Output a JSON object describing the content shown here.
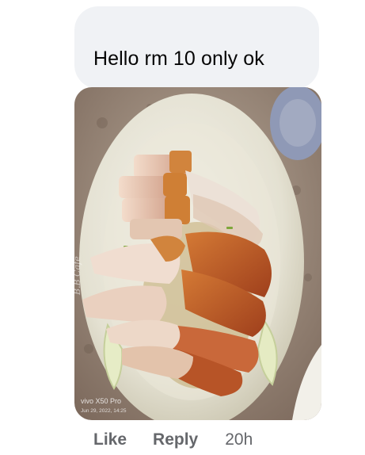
{
  "comment": {
    "text": "Hello rm 10 only ok"
  },
  "photo": {
    "description_icon": "food-photo",
    "watermark_logo": "B.B Cafe",
    "watermark_device": "vivo X50 Pro",
    "watermark_date": "Jun 29, 2022, 14:25"
  },
  "actions": {
    "like_label": "Like",
    "reply_label": "Reply",
    "timestamp": "20h"
  },
  "colors": {
    "bubble_bg": "#f0f2f5",
    "text": "#050505",
    "secondary_text": "#65676b"
  }
}
